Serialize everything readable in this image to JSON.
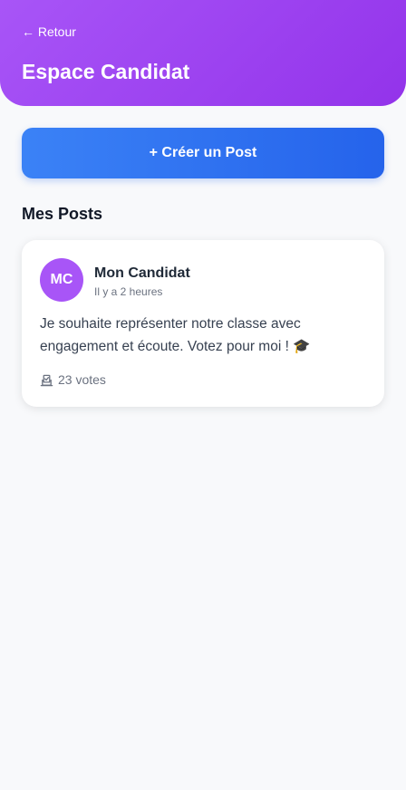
{
  "header": {
    "back_label": "← Retour",
    "title": "Espace Candidat",
    "gradient_colors": [
      "#a855f7",
      "#9333ea"
    ]
  },
  "actions": {
    "create_post_label": "+ Créer un Post",
    "button_color": "#2563eb"
  },
  "section": {
    "title": "Mes Posts"
  },
  "posts": [
    {
      "avatar_initials": "MC",
      "avatar_color": "#a855f7",
      "author": "Mon Candidat",
      "time": "Il y a 2 heures",
      "text": "Je souhaite représenter notre classe avec engagement et écoute. Votez pour moi ! 🎓",
      "votes": "23 votes",
      "vote_icon": "ballot-box-icon"
    }
  ]
}
